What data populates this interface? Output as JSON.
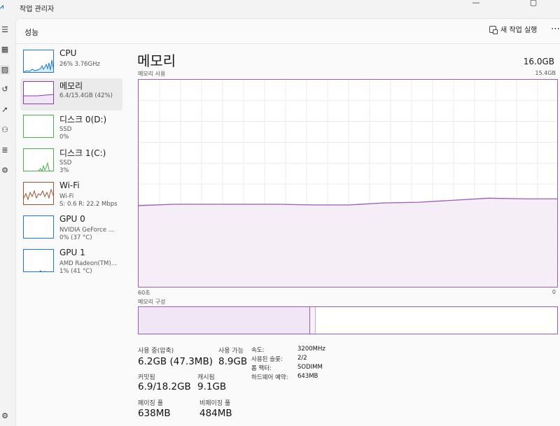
{
  "window": {
    "title": "작업 관리자",
    "app_icon": "task-manager-icon",
    "controls": {
      "minimize": "—",
      "maximize": "▢",
      "close": "✕"
    }
  },
  "rail": {
    "icons": [
      "menu-icon",
      "processes-icon",
      "performance-icon",
      "app-history-icon",
      "startup-icon",
      "users-icon",
      "details-icon",
      "services-icon",
      "settings-icon"
    ]
  },
  "header": {
    "title": "성능",
    "new_task_label": "새 작업 실행",
    "more_label": "⋯"
  },
  "resources": [
    {
      "name": "CPU",
      "sub1": "26% 3.76GHz",
      "sub2": "",
      "color": "#1f77c9"
    },
    {
      "name": "메모리",
      "sub1": "6.4/15.4GB (42%)",
      "sub2": "",
      "color": "#8b3aa8"
    },
    {
      "name": "디스크 0(D:)",
      "sub1": "SSD",
      "sub2": "0%",
      "color": "#4caf50"
    },
    {
      "name": "디스크 1(C:)",
      "sub1": "SSD",
      "sub2": "3%",
      "color": "#4caf50"
    },
    {
      "name": "Wi-Fi",
      "sub1": "Wi-Fi",
      "sub2": "S: 0.6  R: 22.2 Mbps",
      "color": "#a0522d"
    },
    {
      "name": "GPU 0",
      "sub1": "NVIDIA GeForce ...",
      "sub2": "0% (37 °C)",
      "color": "#1f77c9"
    },
    {
      "name": "GPU 1",
      "sub1": "AMD Radeon(TM)...",
      "sub2": "1% (41 °C)",
      "color": "#1f77c9"
    }
  ],
  "detail": {
    "title": "메모리",
    "total": "16.0GB",
    "usage_label": "메모리 사용",
    "usage_max": "15.4GB",
    "axis_left": "60초",
    "axis_right": "0",
    "composition_label": "메모리 구성",
    "composition_used_fraction": 0.41,
    "accent_color": "#9a5cb4"
  },
  "chart_data": {
    "type": "area",
    "title": "메모리 사용",
    "ylabel": "",
    "ylim": [
      0,
      15.4
    ],
    "xlabel": "",
    "x_labels": [
      "60초",
      "0"
    ],
    "x": [
      60,
      55,
      50,
      45,
      40,
      35,
      30,
      25,
      20,
      15,
      10,
      5,
      0
    ],
    "values": [
      6.1,
      6.2,
      6.2,
      6.2,
      6.2,
      6.15,
      6.15,
      6.3,
      6.35,
      6.5,
      6.65,
      6.6,
      6.6
    ],
    "color": "#9a5cb4",
    "grid": true
  },
  "stats": {
    "in_use_label": "사용 중(압축)",
    "in_use_value": "6.2GB (47.3MB)",
    "available_label": "사용 가능",
    "available_value": "8.9GB",
    "committed_label": "커밋됨",
    "committed_value": "6.9/18.2GB",
    "cached_label": "캐시됨",
    "cached_value": "9.1GB",
    "paged_label": "페이징 풀",
    "paged_value": "638MB",
    "nonpaged_label": "비페이징 풀",
    "nonpaged_value": "484MB"
  },
  "specs": [
    {
      "label": "속도:",
      "value": "3200MHz"
    },
    {
      "label": "사용된 슬롯:",
      "value": "2/2"
    },
    {
      "label": "폼 팩터:",
      "value": "SODIMM"
    },
    {
      "label": "하드웨어 예약:",
      "value": "643MB"
    }
  ]
}
